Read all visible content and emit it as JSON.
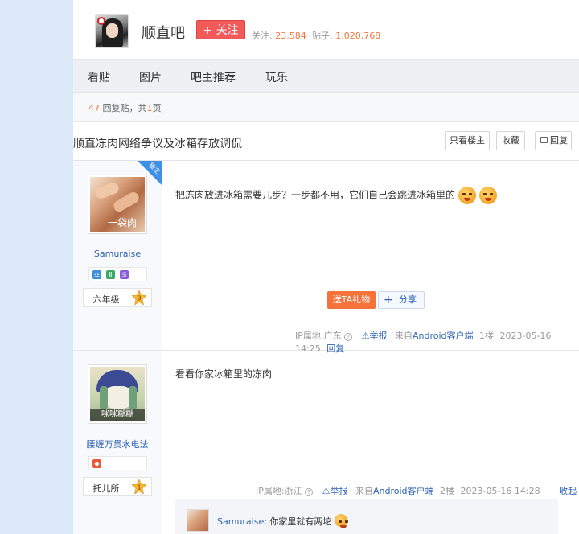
{
  "forum": {
    "name": "顺直吧",
    "follow_label": "+ 关注",
    "followers_label": "关注:",
    "followers": "23,584",
    "posts_label": "贴子:",
    "posts": "1,020,768"
  },
  "nav": {
    "items": [
      {
        "label": "看贴"
      },
      {
        "label": "图片"
      },
      {
        "label": "吧主推荐"
      },
      {
        "label": "玩乐"
      }
    ]
  },
  "thread": {
    "reply_count": "47",
    "reply_label": "回复贴，共",
    "page_count": "1",
    "page_label": "页",
    "title": "顺直冻肉网络争议及冰箱存放调侃",
    "buttons": {
      "only_op": "只看楼主",
      "favorite": "收藏",
      "reply": "回复"
    }
  },
  "posts": [
    {
      "author": "Samuraise",
      "level_name": "六年级",
      "level": "9",
      "op_badge": "楼主",
      "avatar_caption": "一袋肉",
      "content": "把冻肉放进冰箱需要几步？一步都不用，它们自己会跳进冰箱里的",
      "gift_label": "送TA礼物",
      "share_label": "分享",
      "ip": "IP属地:广东",
      "report": "举报",
      "from_prefix": "来自",
      "client": "Android客户端",
      "floor": "1楼",
      "time": "2023-05-16 14:25",
      "reply": "回复"
    },
    {
      "author": "腰缠万贯水电法",
      "level_name": "托儿所",
      "level": "1",
      "avatar_caption": "咪咪糊糊",
      "content": "看看你家冰箱里的冻肉",
      "ip": "IP属地:浙江",
      "report": "举报",
      "from_prefix": "来自",
      "client": "Android客户端",
      "floor": "2楼",
      "time": "2023-05-16 14:28",
      "reply": "收起回复",
      "sub_reply": {
        "author": "Samuraise:",
        "text": "你家里就有两坨"
      }
    }
  ],
  "colors": {
    "accent_orange": "#f5733b",
    "link_blue": "#2d64b3",
    "follow_red": "#f25a5a",
    "sidebar_bg": "#dbe9f8"
  }
}
